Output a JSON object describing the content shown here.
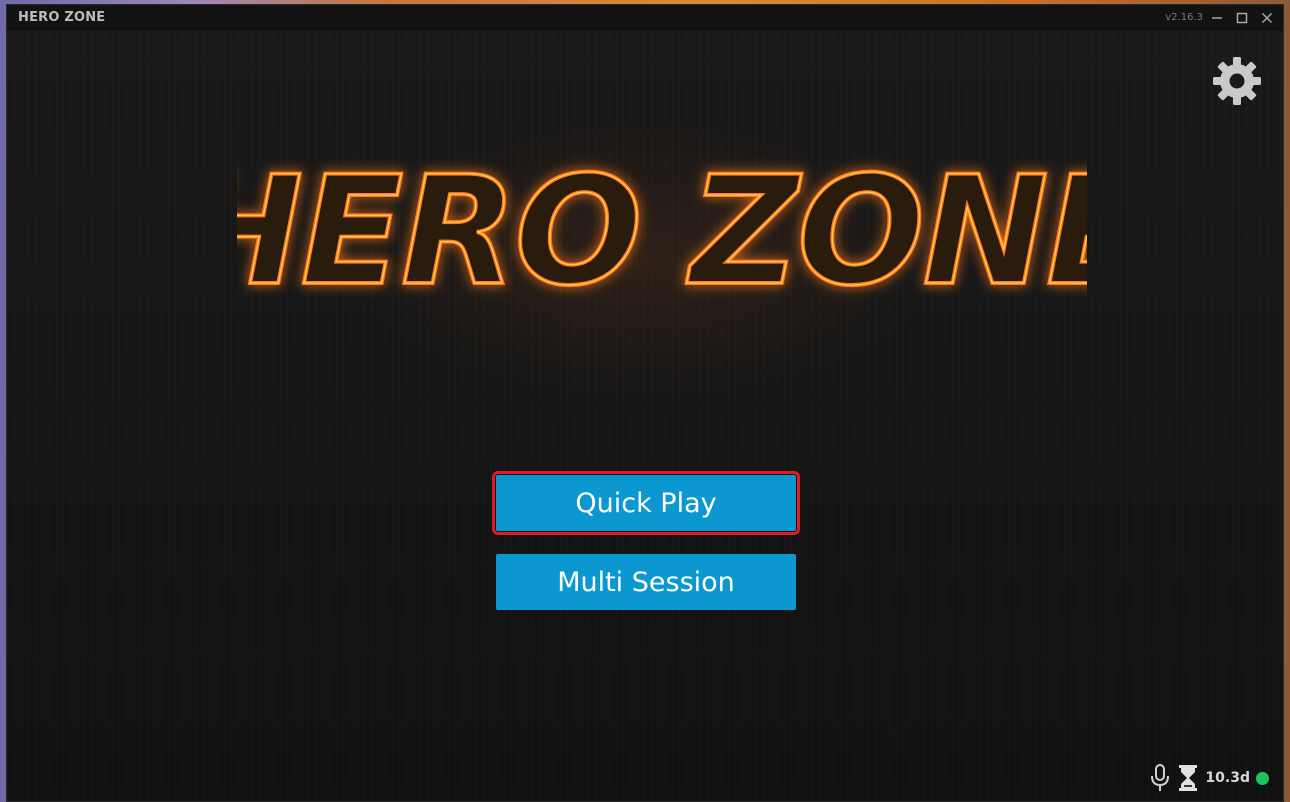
{
  "window": {
    "title": "HERO ZONE",
    "version": "v2.16.3",
    "controls": {
      "minimize": "minimize-icon",
      "maximize": "maximize-icon",
      "close": "close-icon"
    }
  },
  "logo": {
    "text": "HERO ZONE"
  },
  "settings": {
    "icon": "gear-icon"
  },
  "buttons": {
    "quick_play": "Quick Play",
    "multi_session": "Multi Session"
  },
  "status": {
    "time_remaining": "10.3d",
    "mic_icon": "microphone-icon",
    "hourglass_icon": "hourglass-icon",
    "online_color": "#1fc15a"
  },
  "colors": {
    "button": "#0b98d0",
    "highlight_border": "#e01b24",
    "logo_fire": "#ff7a1a",
    "logo_accent": "#37c7ff"
  }
}
